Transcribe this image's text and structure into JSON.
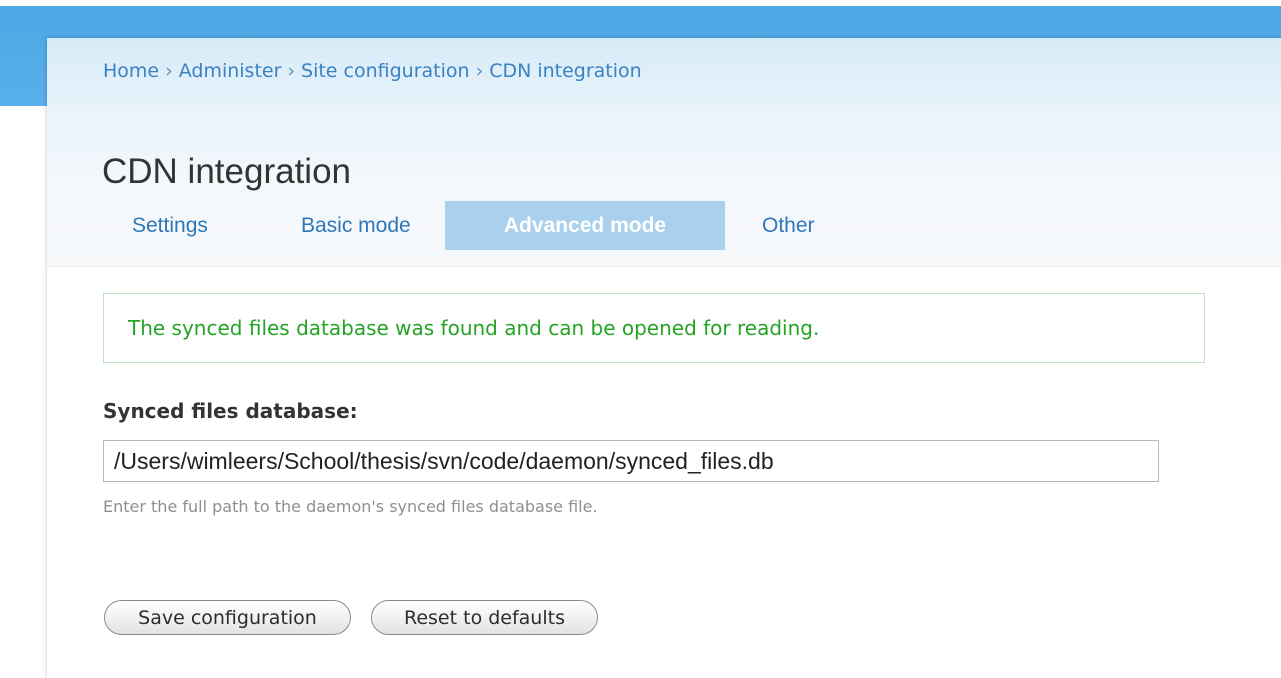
{
  "breadcrumb": {
    "items": [
      "Home",
      "Administer",
      "Site configuration",
      "CDN integration"
    ],
    "separator": "›"
  },
  "page": {
    "title": "CDN integration"
  },
  "tabs": [
    {
      "label": "Settings",
      "active": false
    },
    {
      "label": "Basic mode",
      "active": false
    },
    {
      "label": "Advanced mode",
      "active": true
    },
    {
      "label": "Other",
      "active": false
    }
  ],
  "status": {
    "message": "The synced files database was found and can be opened for reading."
  },
  "form": {
    "synced_db": {
      "label": "Synced files database:",
      "value": "/Users/wimleers/School/thesis/svn/code/daemon/synced_files.db",
      "description": "Enter the full path to the daemon's synced files database file."
    },
    "save_label": "Save configuration",
    "reset_label": "Reset to defaults"
  },
  "colors": {
    "header_blue": "#4da7e5",
    "link": "#3a82c4",
    "active_tab_bg": "#a9d1ed",
    "status_text": "#25a325",
    "status_border": "#bde5bd"
  }
}
